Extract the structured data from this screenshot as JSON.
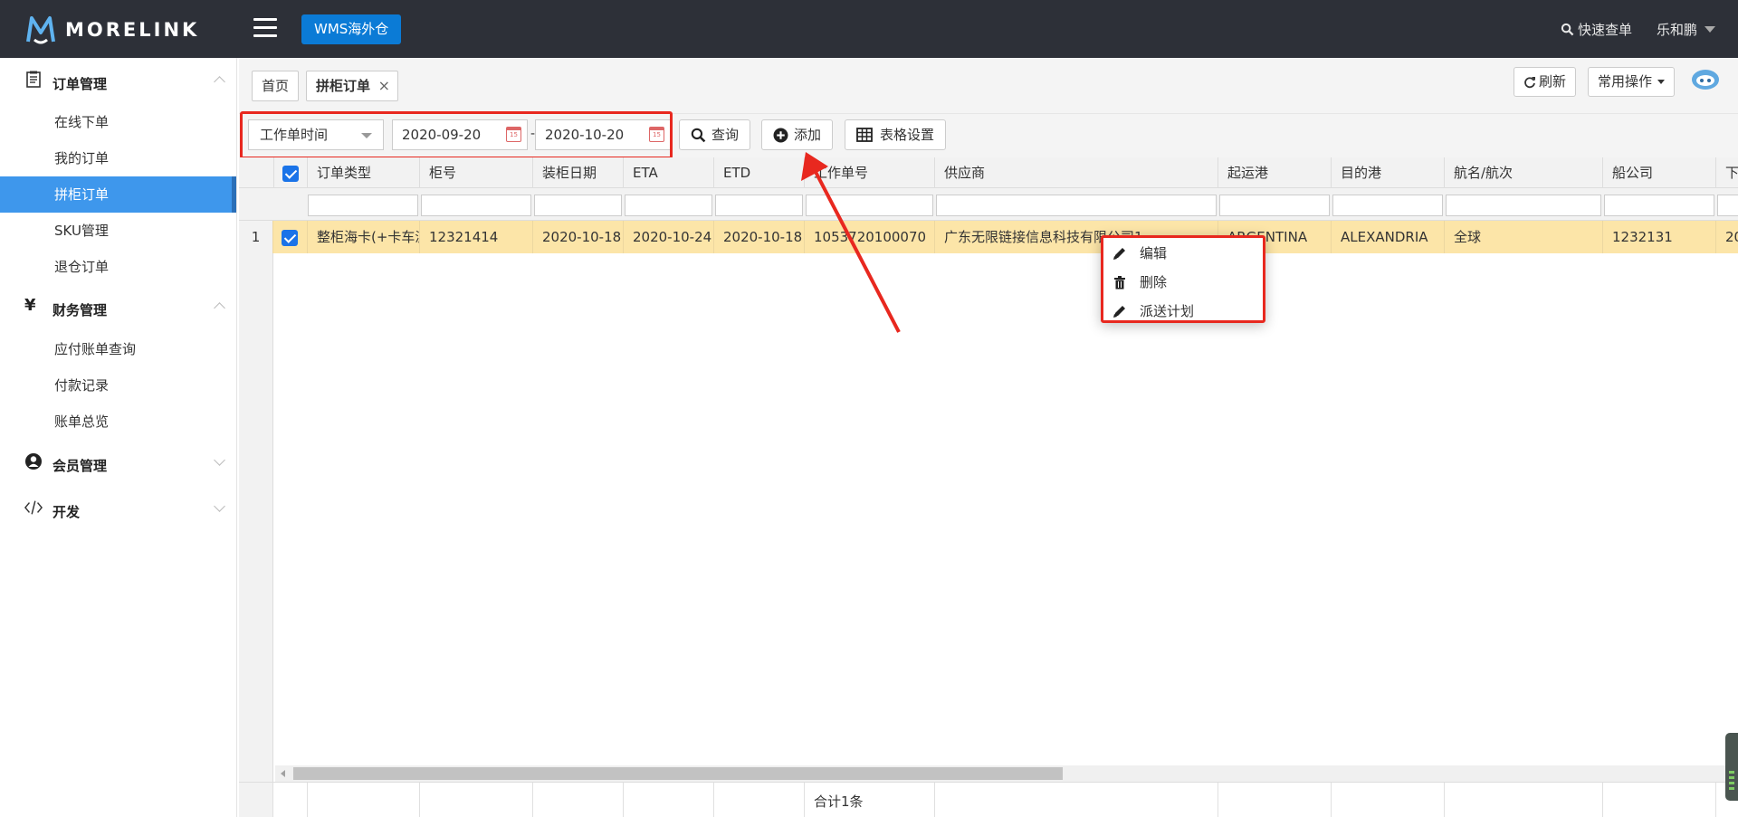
{
  "header": {
    "logo_text": "MORELINK",
    "module_button": "WMS海外仓",
    "quick_search": "快速查单",
    "user_name": "乐和鹏"
  },
  "sidebar": {
    "groups": [
      {
        "label": "订单管理",
        "icon": "order-list-icon",
        "expanded": true,
        "items": [
          "在线下单",
          "我的订单",
          "拼柜订单",
          "SKU管理",
          "退仓订单"
        ]
      },
      {
        "label": "财务管理",
        "icon": "yuan-icon",
        "expanded": true,
        "items": [
          "应付账单查询",
          "付款记录",
          "账单总览"
        ]
      },
      {
        "label": "会员管理",
        "icon": "user-icon",
        "expanded": false,
        "items": []
      },
      {
        "label": "开发",
        "icon": "code-icon",
        "expanded": false,
        "items": []
      }
    ],
    "active_item": "拼柜订单"
  },
  "tabs": {
    "home": "首页",
    "current": "拼柜订单",
    "close_symbol": "×"
  },
  "top_actions": {
    "refresh": "刷新",
    "common_ops": "常用操作"
  },
  "toolbar": {
    "date_type": "工作单时间",
    "date_from": "2020-09-20",
    "date_to": "2020-10-20",
    "date_sep": "-",
    "query": "查询",
    "add": "添加",
    "table_settings": "表格设置"
  },
  "table": {
    "columns": [
      "订单类型",
      "柜号",
      "装柜日期",
      "ETA",
      "ETD",
      "工作单号",
      "供应商",
      "起运港",
      "目的港",
      "航名/航次",
      "船公司",
      "下"
    ],
    "rows": [
      {
        "index": "1",
        "checked": true,
        "cells": [
          "整柜海卡(+卡车派",
          "12321414",
          "2020-10-18",
          "2020-10-24",
          "2020-10-18",
          "1053720100070",
          "广东无限链接信息科技有限公司1",
          "ARGENTINA",
          "ALEXANDRIA",
          "全球",
          "1232131",
          "20"
        ]
      }
    ],
    "footer_total": "合计1条"
  },
  "context_menu": {
    "items": [
      {
        "label": "编辑",
        "icon": "pencil-icon"
      },
      {
        "label": "删除",
        "icon": "trash-icon"
      },
      {
        "label": "派送计划",
        "icon": "pencil-icon"
      }
    ]
  },
  "colors": {
    "topbar": "#2d3038",
    "accent": "#0b7bd6",
    "active_nav": "#3e97ec",
    "selected_row": "#fce5a8",
    "annotation_red": "#e8281f"
  }
}
